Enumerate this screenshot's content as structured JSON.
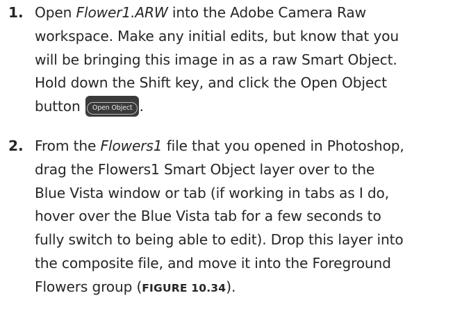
{
  "steps": [
    {
      "number": "1.",
      "lines": [
        {
          "pre": "Open ",
          "em": "Flower1.ARW",
          "post": " into the Adobe Camera Raw"
        },
        {
          "text": "workspace. Make any initial edits, but know that you"
        },
        {
          "text": "will be bringing this image in as a raw Smart Object."
        },
        {
          "text": "Hold down the Shift key, and click the Open Object"
        },
        {
          "pre": "button ",
          "button_label": "Open Object",
          "post": "."
        }
      ]
    },
    {
      "number": "2.",
      "lines": [
        {
          "pre": "From the ",
          "em": "Flowers1",
          "post": " file that you opened in Photoshop,"
        },
        {
          "text": "drag the Flowers1 Smart Object layer over to the"
        },
        {
          "text": "Blue Vista window or tab (if working in tabs as I do,"
        },
        {
          "text": "hover over the Blue Vista tab for a few seconds to"
        },
        {
          "text": "fully switch to being able to edit). Drop this layer into"
        },
        {
          "text": "the composite file, and move it into the Foreground"
        },
        {
          "pre": "Flowers group (",
          "fig": "FIGURE 10.34",
          "post": ")."
        }
      ]
    }
  ]
}
